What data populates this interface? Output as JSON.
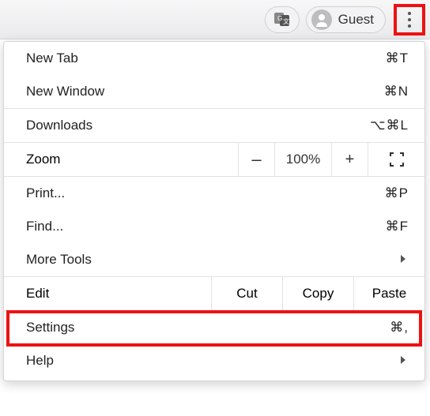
{
  "toolbar": {
    "guest_label": "Guest"
  },
  "menu": {
    "new_tab": {
      "label": "New Tab",
      "shortcut": "⌘T"
    },
    "new_window": {
      "label": "New Window",
      "shortcut": "⌘N"
    },
    "downloads": {
      "label": "Downloads",
      "shortcut": "⌥⌘L"
    },
    "zoom": {
      "label": "Zoom",
      "minus": "–",
      "value": "100%",
      "plus": "+"
    },
    "print": {
      "label": "Print...",
      "shortcut": "⌘P"
    },
    "find": {
      "label": "Find...",
      "shortcut": "⌘F"
    },
    "more_tools": {
      "label": "More Tools"
    },
    "edit": {
      "label": "Edit",
      "cut": "Cut",
      "copy": "Copy",
      "paste": "Paste"
    },
    "settings": {
      "label": "Settings",
      "shortcut": "⌘,"
    },
    "help": {
      "label": "Help"
    }
  }
}
